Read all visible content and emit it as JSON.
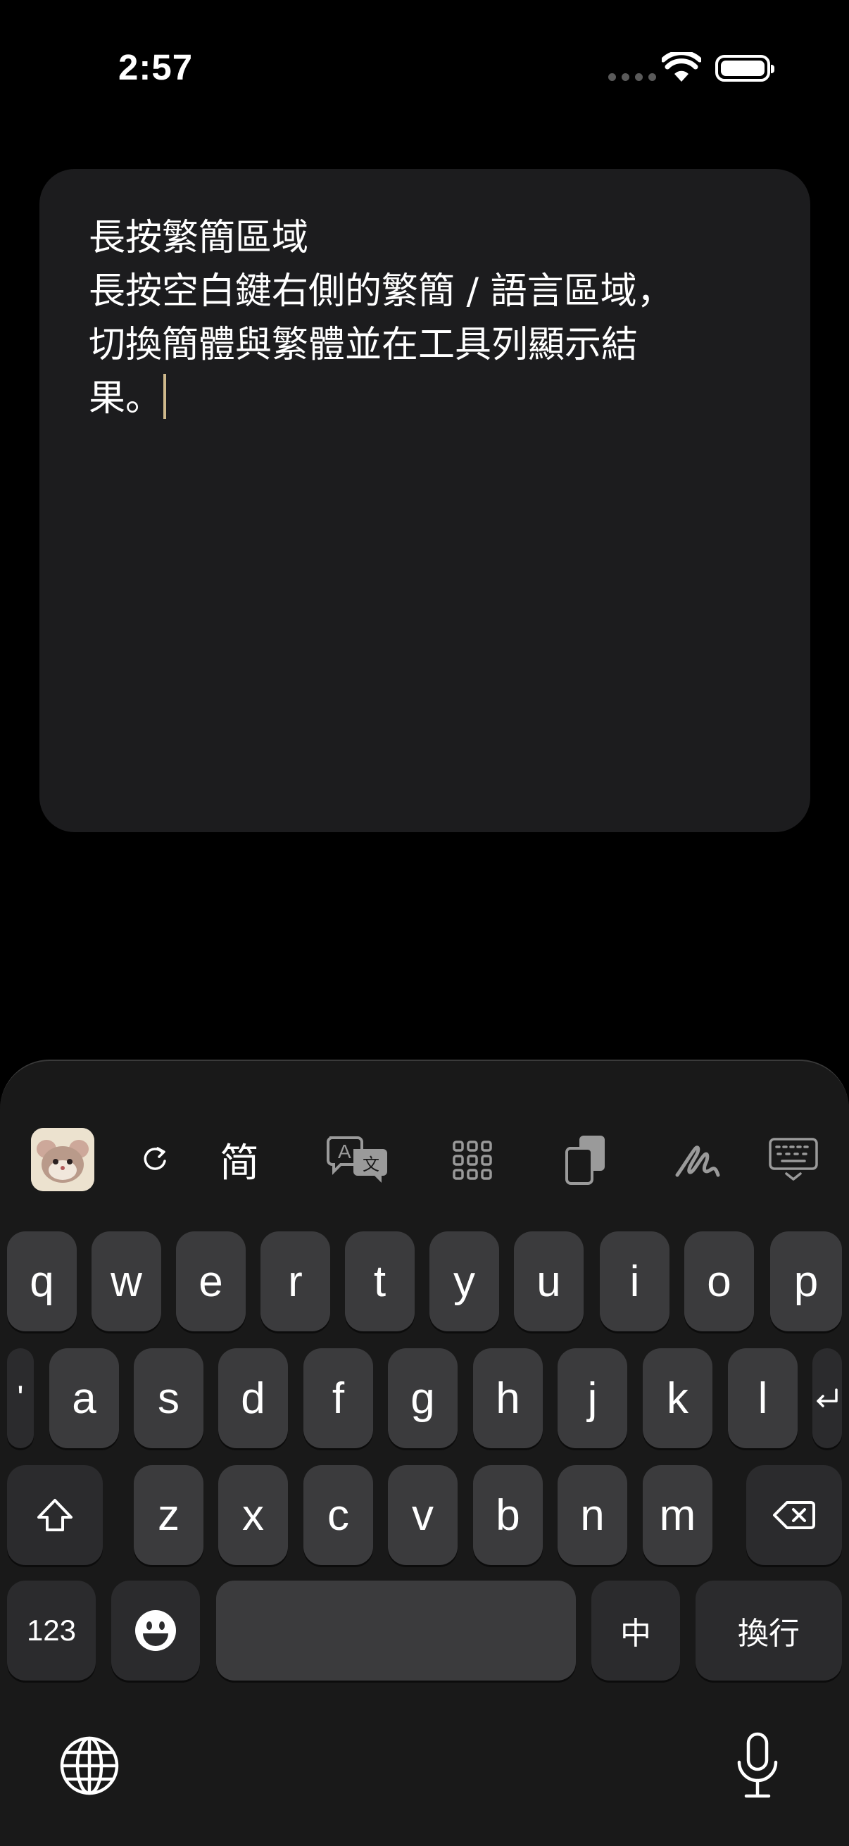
{
  "status_bar": {
    "time": "2:57"
  },
  "text_card": {
    "lines": [
      "長按繁簡區域",
      "長按空白鍵右側的繁簡 / 語言區域，",
      "切換簡體與繁體並在工具列顯示結",
      "果。"
    ]
  },
  "toolbar": {
    "app_icon": "hamster-app-icon",
    "refresh_icon": "refresh-icon",
    "simplified_label": "简",
    "icons": [
      "translate-icon",
      "grid-icon",
      "clipboard-icon",
      "handwriting-icon",
      "keyboard-dismiss-icon"
    ]
  },
  "keys": {
    "row1": [
      "q",
      "w",
      "e",
      "r",
      "t",
      "y",
      "u",
      "i",
      "o",
      "p"
    ],
    "row2": [
      "a",
      "s",
      "d",
      "f",
      "g",
      "h",
      "j",
      "k",
      "l"
    ],
    "row3": [
      "z",
      "x",
      "c",
      "v",
      "b",
      "n",
      "m"
    ],
    "apostrophe": "'",
    "numbers": "123",
    "language": "中",
    "return": "換行"
  },
  "bottom": {
    "globe": "globe-icon",
    "mic": "microphone-icon"
  }
}
